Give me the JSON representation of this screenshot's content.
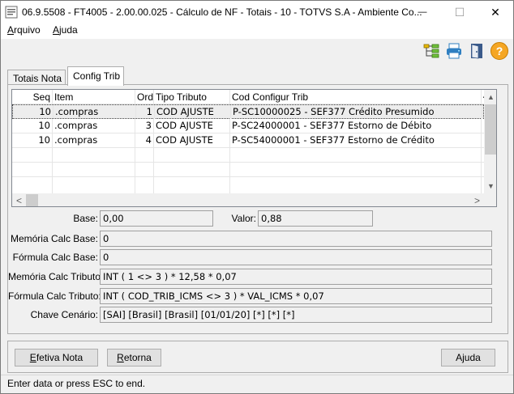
{
  "window": {
    "title": "06.9.5508 - FT4005 - 2.00.00.025 - Cálculo de NF - Totais - 10 - TOTVS S.A - Ambiente Co...",
    "minimize_glyph": "—",
    "maximize_glyph": "☐",
    "close_glyph": "✕"
  },
  "menu": {
    "items": [
      {
        "label_accel": "A",
        "label_rest": "rquivo"
      },
      {
        "label_accel": "A",
        "label_rest": "juda"
      }
    ]
  },
  "toolbar": {
    "icons": [
      "tree-icon",
      "printer-icon",
      "exit-door-icon",
      "help-icon"
    ],
    "help_glyph": "?",
    "colors": {
      "help_bg": "#f5a623",
      "printer": "#2f7fc1"
    }
  },
  "tabs": [
    {
      "label": "Totais Nota",
      "active": false
    },
    {
      "label": "Config Trib",
      "active": true
    }
  ],
  "grid": {
    "columns": [
      "Seq",
      "Item",
      "Ord",
      "Tipo Tributo",
      "Cod Configur Trib",
      "A"
    ],
    "rows": [
      {
        "seq": "10",
        "item": ".compras",
        "ord": "1",
        "tipo": "COD AJUSTE",
        "cod": "P-SC10000025 - SEF377 Crédito Presumido",
        "selected": true
      },
      {
        "seq": "10",
        "item": ".compras",
        "ord": "3",
        "tipo": "COD AJUSTE",
        "cod": "P-SC24000001 - SEF377 Estorno de Débito",
        "selected": false
      },
      {
        "seq": "10",
        "item": ".compras",
        "ord": "4",
        "tipo": "COD AJUSTE",
        "cod": "P-SC54000001 - SEF377 Estorno de Crédito",
        "selected": false
      }
    ],
    "scroll": {
      "up": "▲",
      "down": "▼",
      "left": "<",
      "right": ">"
    }
  },
  "fields": {
    "base": {
      "label": "Base:",
      "value": "0,00"
    },
    "valor": {
      "label": "Valor:",
      "value": "0,88"
    },
    "memoria_calc_base": {
      "label": "Memória Calc Base:",
      "value": "0"
    },
    "formula_calc_base": {
      "label": "Fórmula Calc Base:",
      "value": "0"
    },
    "memoria_calc_tributo": {
      "label": "Memória Calc Tributo:",
      "value": "INT ( 1 <> 3 ) * 12,58 * 0,07"
    },
    "formula_calc_tributo": {
      "label": "Fórmula Calc Tributo:",
      "value": "INT ( COD_TRIB_ICMS <> 3 ) * VAL_ICMS * 0,07"
    },
    "chave_cenario": {
      "label": "Chave Cenário:",
      "value": "[SAI] [Brasil] [Brasil] [01/01/20] [*] [*] [*]"
    }
  },
  "buttons": {
    "efetiva": {
      "accel": "E",
      "rest": "fetiva Nota"
    },
    "retorna": {
      "accel": "R",
      "rest": "etorna"
    },
    "ajuda": {
      "label": "Ajuda"
    }
  },
  "status": {
    "text": "Enter data or press ESC to end."
  }
}
